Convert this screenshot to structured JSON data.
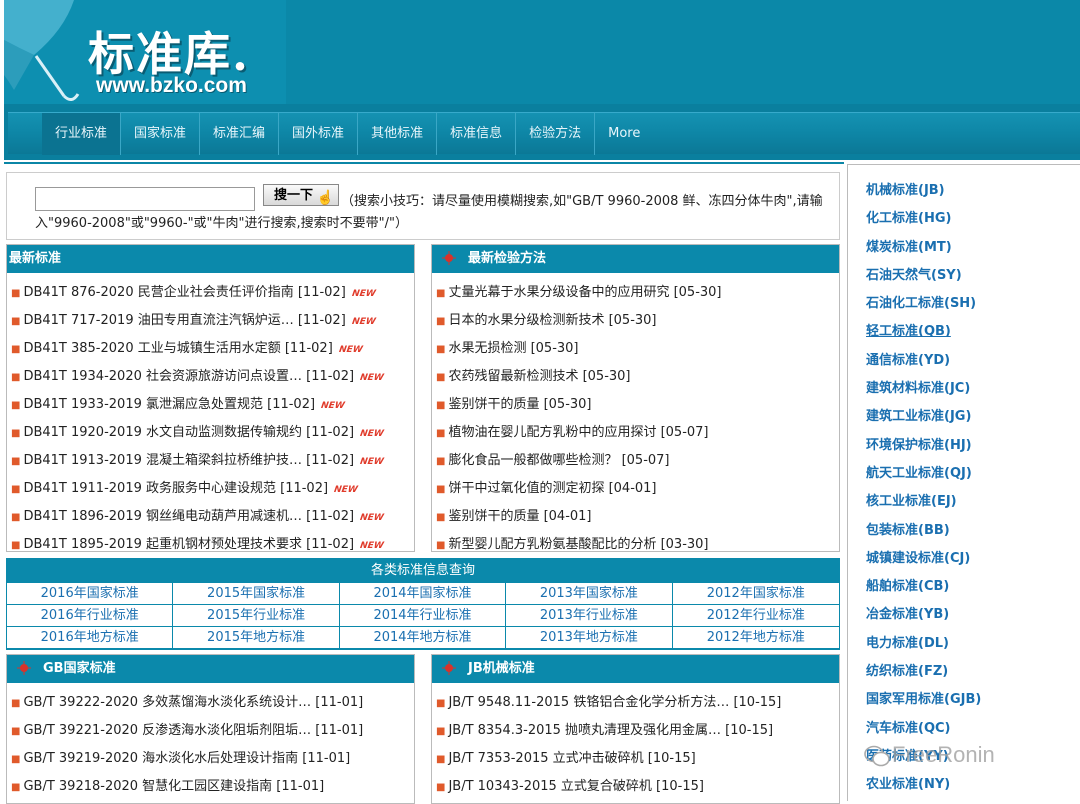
{
  "header": {
    "logo_text": "标准库.",
    "logo_url": "www.bzko.com"
  },
  "nav": [
    "行业标准",
    "国家标准",
    "标准汇编",
    "国外标准",
    "其他标准",
    "标准信息",
    "检验方法",
    "More"
  ],
  "search": {
    "button_label": "搜一下",
    "tip": "（搜索小技巧：请尽量使用模糊搜索,如\"GB/T 9960-2008 鲜、冻四分体牛肉\",请输入\"9960-2008\"或\"9960-\"或\"牛肉\"进行搜索,搜索时不要带\"/\"）",
    "value": ""
  },
  "latest_standards": {
    "title": "最新标准",
    "new_label": "NEW",
    "items": [
      "DB41T 876-2020 民营企业社会责任评价指南 [11-02]",
      "DB41T 717-2019 油田专用直流注汽锅炉运… [11-02]",
      "DB41T 385-2020 工业与城镇生活用水定额 [11-02]",
      "DB41T 1934-2020 社会资源旅游访问点设置… [11-02]",
      "DB41T 1933-2019 氯泄漏应急处置规范 [11-02]",
      "DB41T 1920-2019 水文自动监测数据传输规约 [11-02]",
      "DB41T 1913-2019 混凝土箱梁斜拉桥维护技… [11-02]",
      "DB41T 1911-2019 政务服务中心建设规范 [11-02]",
      "DB41T 1896-2019 钢丝绳电动葫芦用减速机… [11-02]",
      "DB41T 1895-2019 起重机钢材预处理技术要求 [11-02]"
    ]
  },
  "latest_methods": {
    "title": "最新检验方法",
    "items": [
      "丈量光幕于水果分级设备中的应用研究 [05-30]",
      "日本的水果分级检测新技术 [05-30]",
      "水果无损检测 [05-30]",
      "农药残留最新检测技术 [05-30]",
      "鉴别饼干的质量 [05-30]",
      "植物油在婴儿配方乳粉中的应用探讨 [05-07]",
      "膨化食品一般都做哪些检测？ [05-07]",
      "饼干中过氧化值的测定初探 [04-01]",
      "鉴别饼干的质量 [04-01]",
      "新型婴儿配方乳粉氨基酸配比的分析 [03-30]"
    ]
  },
  "info_query": {
    "title": "各类标准信息查询",
    "cells": [
      "2016年国家标准",
      "2015年国家标准",
      "2014年国家标准",
      "2013年国家标准",
      "2012年国家标准",
      "2016年行业标准",
      "2015年行业标准",
      "2014年行业标准",
      "2013年行业标准",
      "2012年行业标准",
      "2016年地方标准",
      "2015年地方标准",
      "2014年地方标准",
      "2013年地方标准",
      "2012年地方标准"
    ]
  },
  "gb_panel": {
    "title": "GB国家标准",
    "items": [
      "GB/T 39222-2020 多效蒸馏海水淡化系统设计… [11-01]",
      "GB/T 39221-2020 反渗透海水淡化阻垢剂阻垢… [11-01]",
      "GB/T 39219-2020 海水淡化水后处理设计指南 [11-01]",
      "GB/T 39218-2020 智慧化工园区建设指南 [11-01]"
    ]
  },
  "jb_panel": {
    "title": "JB机械标准",
    "items": [
      "JB/T 9548.11-2015 铁铬铝合金化学分析方法… [10-15]",
      "JB/T 8354.3-2015 抛喷丸清理及强化用金属… [10-15]",
      "JB/T 7353-2015 立式冲击破碎机 [10-15]",
      "JB/T 10343-2015 立式复合破碎机 [10-15]"
    ]
  },
  "sidebar": {
    "items": [
      "机械标准(JB)",
      "化工标准(HG)",
      "煤炭标准(MT)",
      "石油天然气(SY)",
      "石油化工标准(SH)",
      "轻工标准(QB)",
      "通信标准(YD)",
      "建筑材料标准(JC)",
      "建筑工业标准(JG)",
      "环境保护标准(HJ)",
      "航天工业标准(QJ)",
      "核工业标准(EJ)",
      "包装标准(BB)",
      "城镇建设标准(CJ)",
      "船舶标准(CB)",
      "冶金标准(YB)",
      "电力标准(DL)",
      "纺织标准(FZ)",
      "国家军用标准(GJB)",
      "汽车标准(QC)",
      "医药标准(YY)",
      "农业标准(NY)"
    ],
    "underlined_index": 5
  },
  "watermark": "FreeRonin",
  "colors": {
    "brand": "#0b89ab",
    "link": "#1a6fb0",
    "bullet": "#e05a2b",
    "new_badge": "#e03b2b"
  }
}
